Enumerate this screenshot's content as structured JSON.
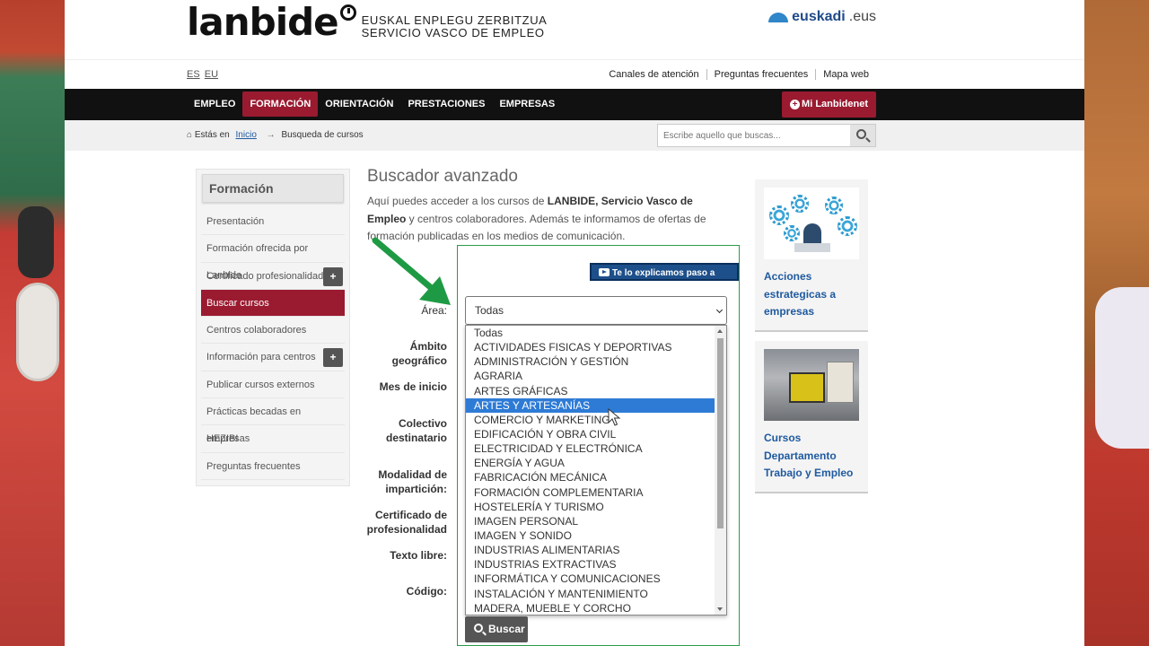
{
  "header": {
    "logo_word": "lanbide",
    "logo_sub_1": "EUSKAL ENPLEGU ZERBITZUA",
    "logo_sub_2": "SERVICIO VASCO DE EMPLEO",
    "euskadi_name": "euskadi",
    "euskadi_suffix": ".eus"
  },
  "languages": [
    "ES",
    "EU"
  ],
  "utility_links": [
    "Canales de atención",
    "Preguntas frecuentes",
    "Mapa web"
  ],
  "nav": {
    "items": [
      "EMPLEO",
      "FORMACIÓN",
      "ORIENTACIÓN",
      "PRESTACIONES",
      "EMPRESAS"
    ],
    "active": "FORMACIÓN",
    "mi_lanbide": "Mi Lanbidenet"
  },
  "breadcrumb": {
    "prefix": "Estás en",
    "home": "Inicio",
    "current": "Busqueda de cursos"
  },
  "search": {
    "placeholder": "Escribe aquello que buscas..."
  },
  "sidebar": {
    "title": "Formación",
    "items": [
      {
        "label": "Presentación"
      },
      {
        "label": "Formación ofrecida por Lanbide"
      },
      {
        "label": "Certificado profesionalidad",
        "expand": "+"
      },
      {
        "label": "Buscar cursos",
        "active": true
      },
      {
        "label": "Centros colaboradores"
      },
      {
        "label": "Información para centros",
        "expand": "+"
      },
      {
        "label": "Publicar cursos externos"
      },
      {
        "label": "Prácticas becadas en empresas"
      },
      {
        "label": "HEZIBI"
      },
      {
        "label": "Preguntas frecuentes"
      }
    ]
  },
  "main": {
    "title": "Buscador avanzado",
    "intro_pre": "Aquí puedes acceder a los cursos de ",
    "intro_bold": "LANBIDE, Servicio Vasco de Empleo",
    "intro_post": " y centros colaboradores. Además te informamos de ofertas de formación publicadas en los medios de comunicación.",
    "video_button": "Te lo explicamos paso a paso",
    "labels": {
      "area": "Área:",
      "ambito_1": "Ámbito",
      "ambito_2": "geográfico",
      "mes": "Mes de inicio",
      "colectivo_1": "Colectivo",
      "colectivo_2": "destinatario",
      "modalidad_1": "Modalidad de",
      "modalidad_2": "impartición:",
      "certificado_1": "Certificado de",
      "certificado_2": "profesionalidad",
      "texto": "Texto libre:",
      "codigo": "Código:"
    },
    "area_selected": "Todas",
    "area_options": [
      "Todas",
      "ACTIVIDADES FISICAS Y DEPORTIVAS",
      "ADMINISTRACIÓN Y GESTIÓN",
      "AGRARIA",
      "ARTES GRÁFICAS",
      "ARTES Y ARTESANÍAS",
      "COMERCIO Y MARKETING",
      "EDIFICACIÓN Y OBRA CIVIL",
      "ELECTRICIDAD Y ELECTRÓNICA",
      "ENERGÍA Y AGUA",
      "FABRICACIÓN MECÁNICA",
      "FORMACIÓN COMPLEMENTARIA",
      "HOSTELERÍA Y TURISMO",
      "IMAGEN PERSONAL",
      "IMAGEN Y SONIDO",
      "INDUSTRIAS ALIMENTARIAS",
      "INDUSTRIAS EXTRACTIVAS",
      "INFORMÁTICA Y COMUNICACIONES",
      "INSTALACIÓN Y MANTENIMIENTO",
      "MADERA, MUEBLE Y CORCHO"
    ],
    "highlighted_option": "ARTES Y ARTESANÍAS",
    "buscar": "Buscar"
  },
  "cards": [
    {
      "title_1": "Acciones",
      "title_2": "estrategicas a",
      "title_3": "empresas",
      "image": "gears-illustration"
    },
    {
      "title_1": "Cursos",
      "title_2": "Departamento",
      "title_3": "Trabajo y Empleo",
      "image": "forklift-photo"
    }
  ],
  "colors": {
    "brand": "#9a1a30",
    "nav_bg": "#111111",
    "link": "#1f5aa0",
    "highlight": "#2e7bd6",
    "annotation_green": "#1f9a44"
  }
}
